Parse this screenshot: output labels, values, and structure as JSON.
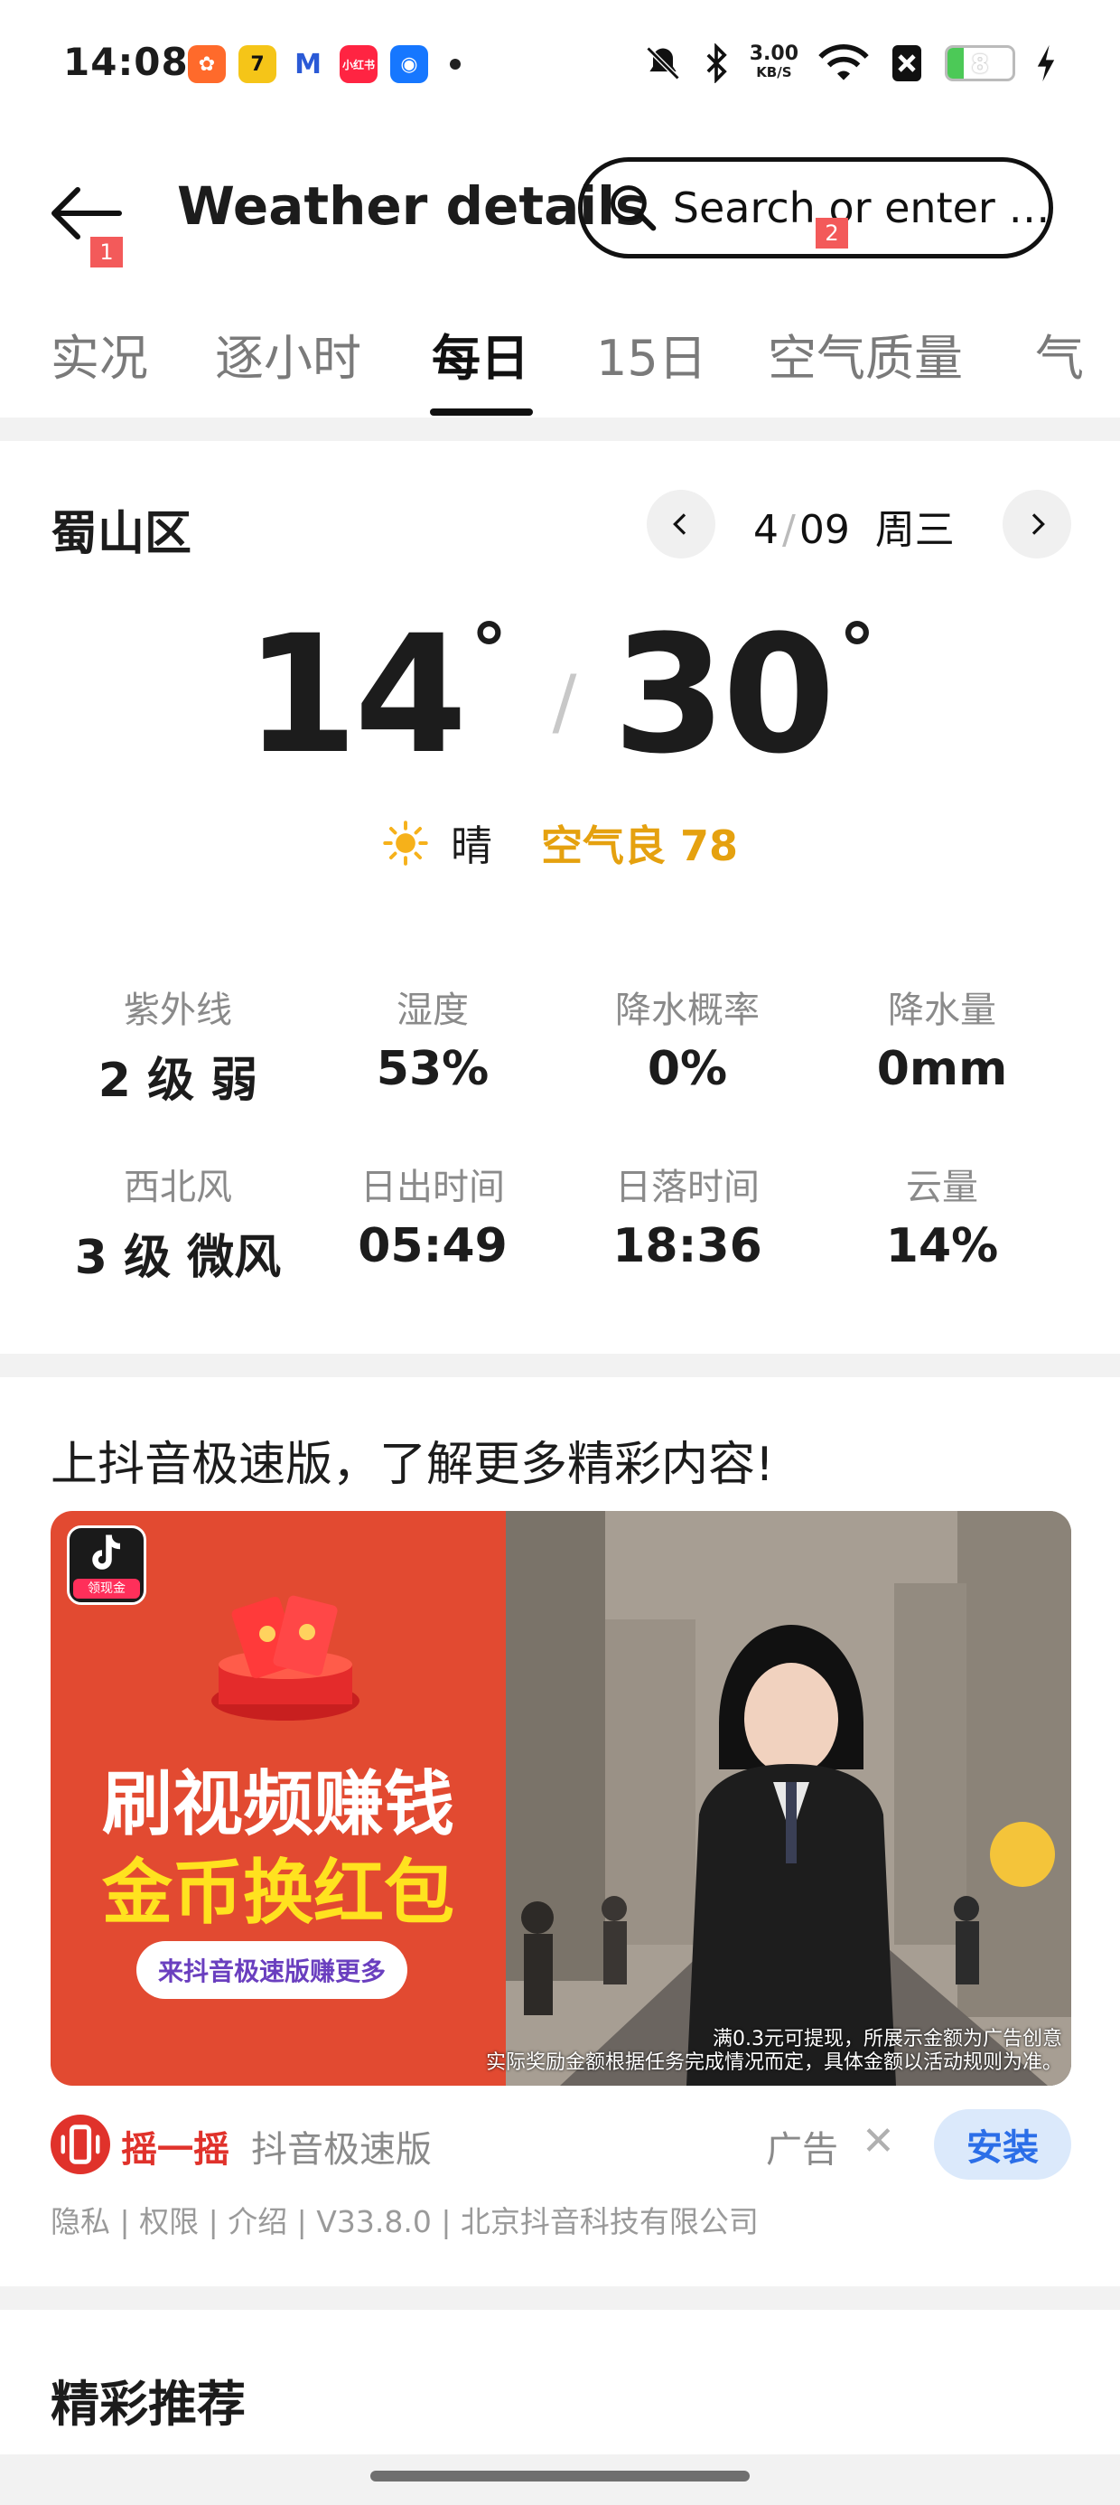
{
  "status_bar": {
    "time": "14:08",
    "app_icons": [
      "kuaishou-icon",
      "qimao-icon",
      "meitu-icon",
      "xiaohongshu-icon",
      "alipay-icon"
    ],
    "speed_value": "3.00",
    "speed_unit": "KB/S",
    "battery": "8",
    "battery_level": 0.08
  },
  "header": {
    "title": "Weather details",
    "search_placeholder": "Search or enter …",
    "badge_back": "1",
    "badge_search": "2"
  },
  "tabs": [
    {
      "label": "实况"
    },
    {
      "label": "逐小时"
    },
    {
      "label": "每日",
      "active": true
    },
    {
      "label": "15日"
    },
    {
      "label": "空气质量"
    },
    {
      "label": "气"
    }
  ],
  "weather": {
    "location": "蜀山区",
    "date_month": "4",
    "date_day": "09",
    "weekday": "周三",
    "temp_low": "14",
    "temp_high": "30",
    "degree": "°",
    "condition": "晴",
    "air_quality": "空气良 78",
    "details": [
      {
        "label": "紫外线",
        "value": "2 级 弱"
      },
      {
        "label": "湿度",
        "value": "53%"
      },
      {
        "label": "降水概率",
        "value": "0%"
      },
      {
        "label": "降水量",
        "value": "0mm"
      },
      {
        "label": "西北风",
        "value": "3 级 微风"
      },
      {
        "label": "日出时间",
        "value": "05:49"
      },
      {
        "label": "日落时间",
        "value": "18:36"
      },
      {
        "label": "云量",
        "value": "14%"
      }
    ]
  },
  "ad": {
    "title": "上抖音极速版，了解更多精彩内容!",
    "headline_1": "刷视频赚钱",
    "headline_2": "金币换红包",
    "cta": "来抖音极速版赚更多",
    "app_icon_sub": "领现金",
    "disclaimer_1": "满0.3元可提现，所展示金额为广告创意",
    "disclaimer_2": "实际奖励金额根据任务完成情况而定，具体金额以活动规则为准。",
    "shake": "摇一摇",
    "app_name": "抖音极速版",
    "ad_label": "广告",
    "install": "安装",
    "links": "隐私 | 权限 | 介绍 | V33.8.0 | 北京抖音科技有限公司"
  },
  "recommend": {
    "title": "精彩推荐"
  },
  "colors": {
    "accent_air": "#e5a10f",
    "ad_red": "#e24a31",
    "install_blue": "#2b6ee8"
  }
}
